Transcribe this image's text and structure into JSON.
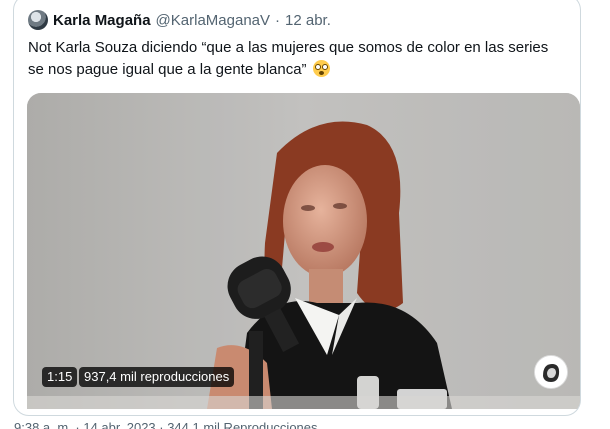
{
  "tweet": {
    "display_name": "Karla Magaña",
    "handle": "@KarlaMaganaV",
    "separator": "·",
    "date": "12 abr.",
    "text": "Not Karla Souza diciendo “que a las mujeres que somos de color en las series se nos pague igual que a la gente blanca”",
    "emoji": "flushed-face-emoji"
  },
  "video": {
    "duration": "1:15",
    "views": "937,4 mil reproducciones"
  },
  "footer": {
    "partial_text": "9:38 a. m. · 14 abr. 2023 · 344,1 mil Reproducciones"
  },
  "colors": {
    "text_primary": "#0f1419",
    "text_secondary": "#536471",
    "border": "#cfd9de",
    "badge_bg": "#000000"
  }
}
